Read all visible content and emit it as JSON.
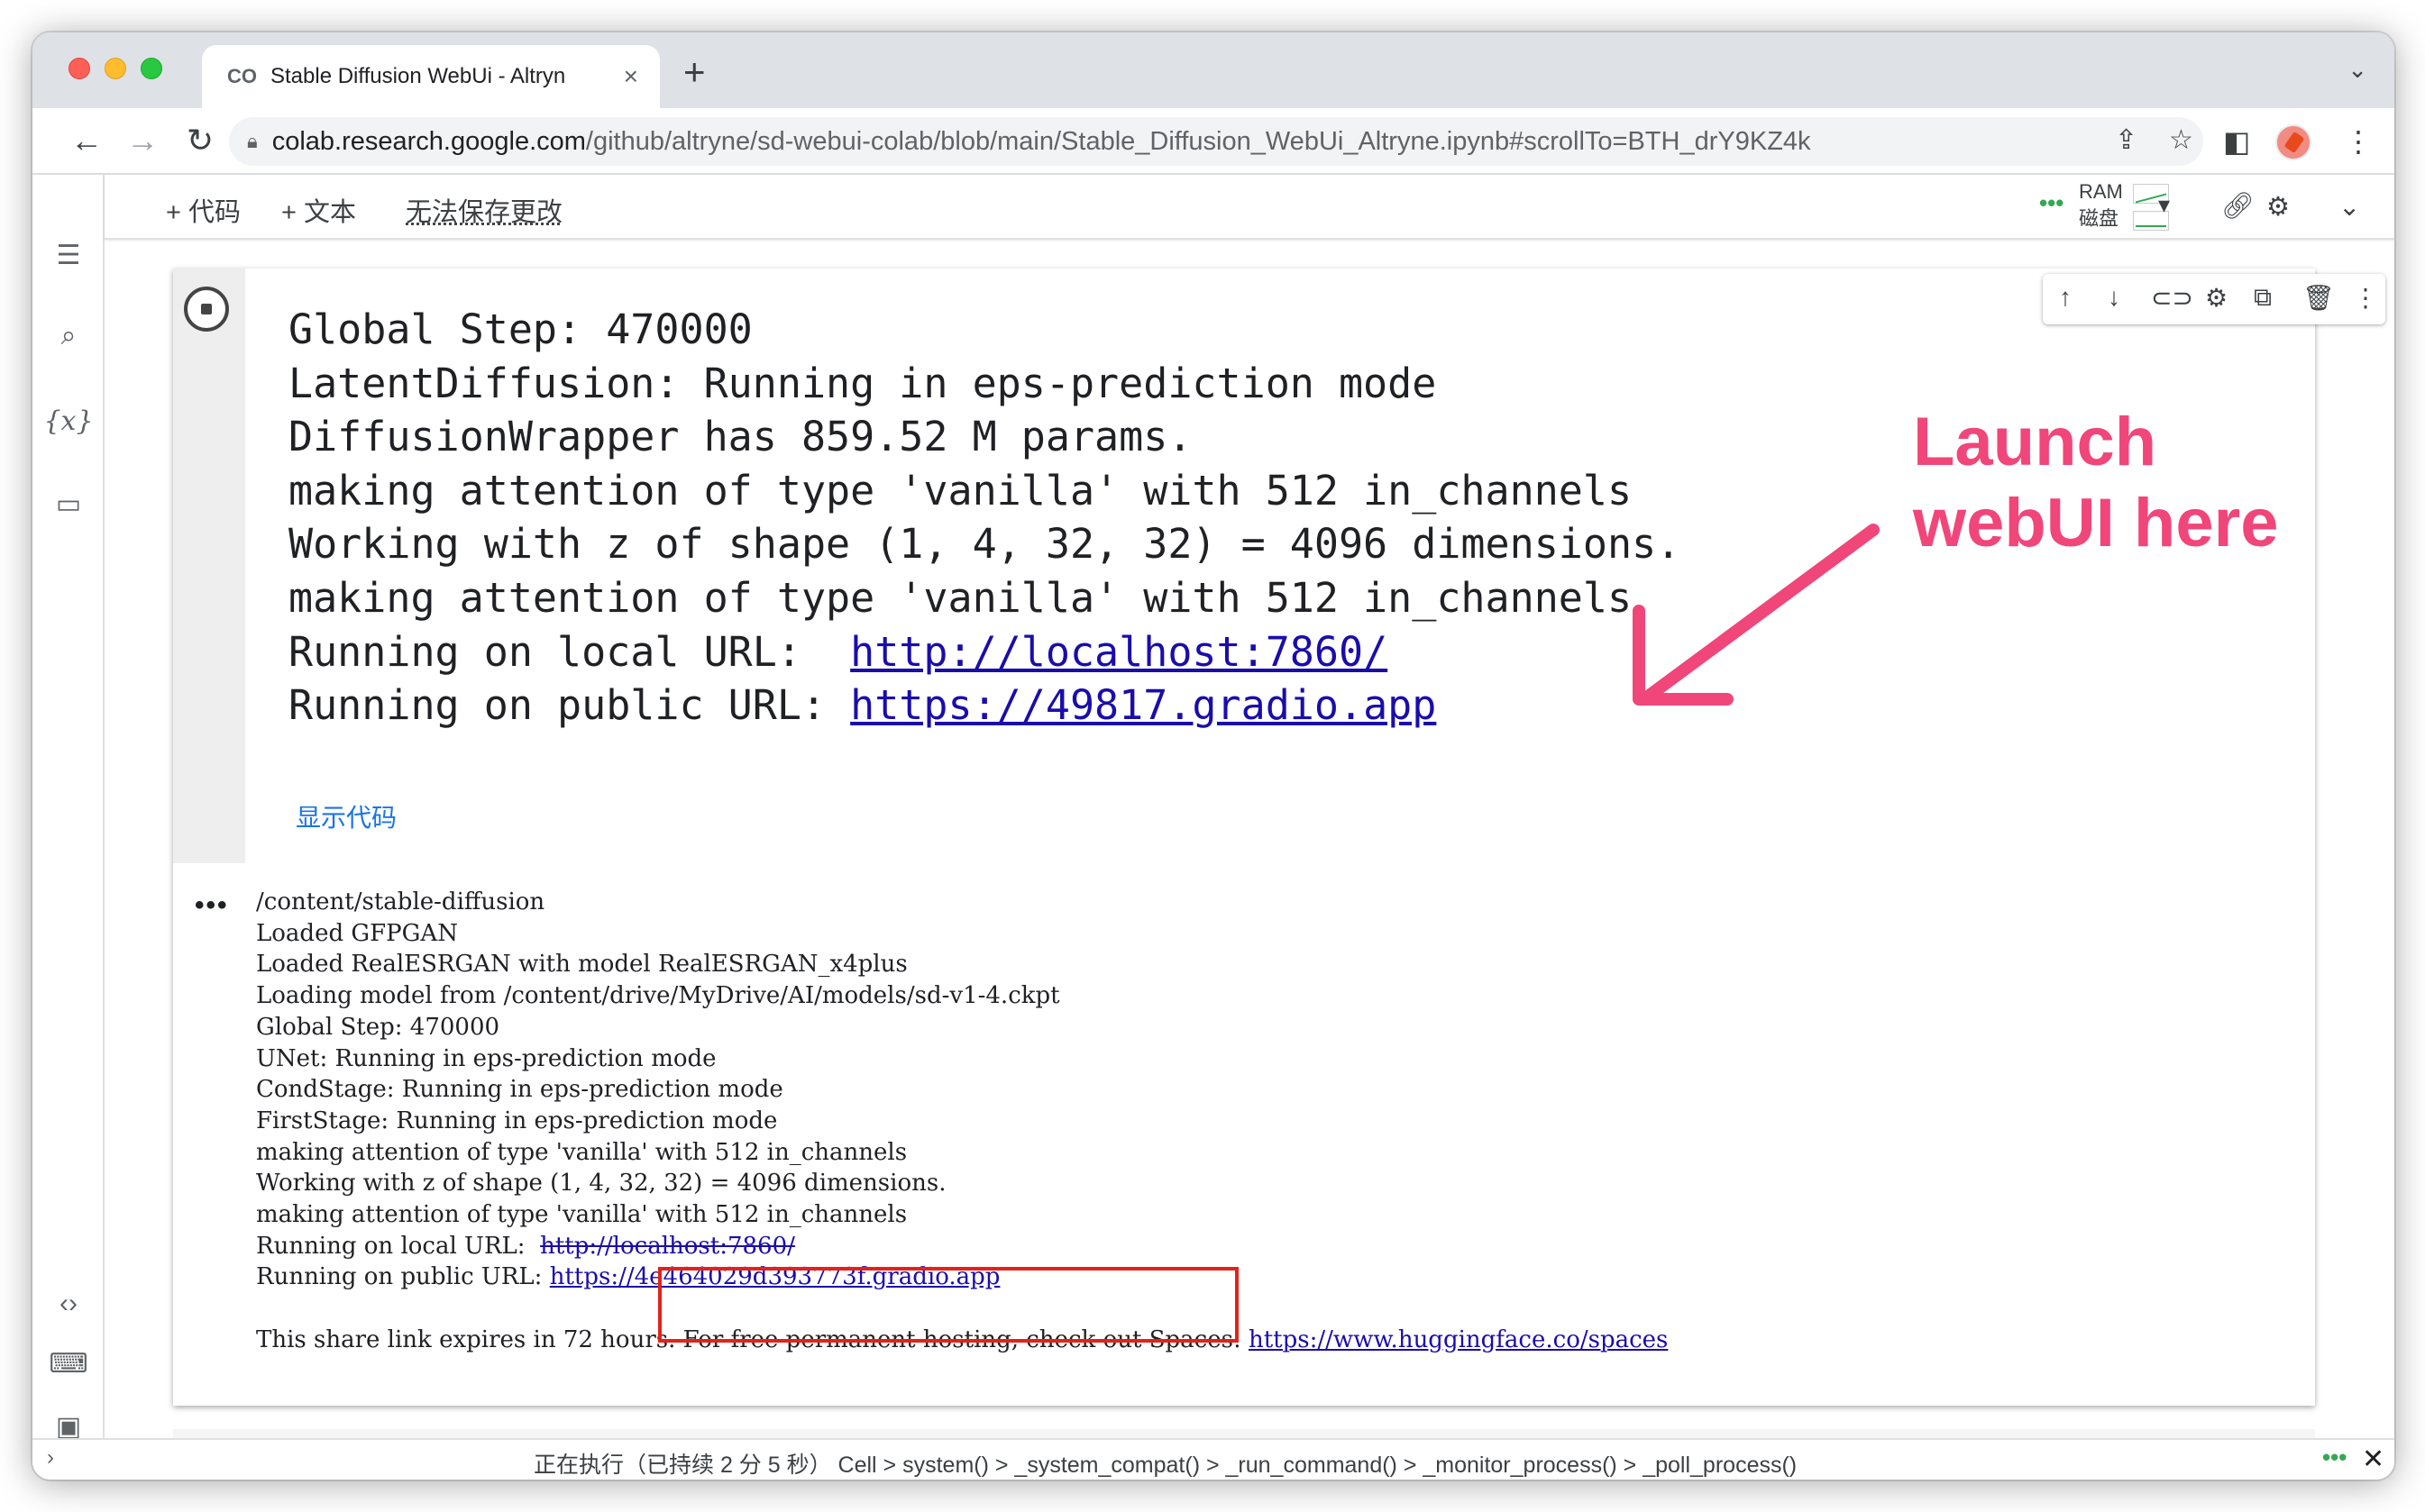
{
  "browser": {
    "tab_title": "Stable Diffusion WebUi - Altryn",
    "tab_close": "×",
    "new_tab": "+",
    "tab_search": "⌄",
    "url_host": "colab.research.google.com",
    "url_path": "/github/altryne/sd-webui-colab/blob/main/Stable_Diffusion_WebUi_Altryne.ipynb#scrollTo=BTH_drY9KZ4k"
  },
  "colab_header": {
    "add_code": "+ 代码",
    "add_text": "+ 文本",
    "save_status": "无法保存更改",
    "ram_label": "RAM",
    "disk_label": "磁盘",
    "dropdown": "▾"
  },
  "cell_form_output": {
    "lines": [
      "Global Step: 470000",
      "LatentDiffusion: Running in eps-prediction mode",
      "DiffusionWrapper has 859.52 M params.",
      "making attention of type 'vanilla' with 512 in_channels",
      "Working with z of shape (1, 4, 32, 32) = 4096 dimensions.",
      "making attention of type 'vanilla' with 512 in_channels"
    ],
    "local_prefix": "Running on local URL:  ",
    "local_url": "http://localhost:7860/",
    "public_prefix": "Running on public URL: ",
    "public_url": "https://49817.gradio.app",
    "show_code": "显示代码"
  },
  "cell_output": {
    "lines": [
      "/content/stable-diffusion",
      "Loaded GFPGAN",
      "Loaded RealESRGAN with model RealESRGAN_x4plus",
      "Loading model from /content/drive/MyDrive/AI/models/sd-v1-4.ckpt",
      "Global Step: 470000",
      "UNet: Running in eps-prediction mode",
      "CondStage: Running in eps-prediction mode",
      "FirstStage: Running in eps-prediction mode",
      "making attention of type 'vanilla' with 512 in_channels",
      "Working with z of shape (1, 4, 32, 32) = 4096 dimensions.",
      "making attention of type 'vanilla' with 512 in_channels"
    ],
    "local_prefix": "Running on local URL:  ",
    "local_url": "http://localhost:7860/",
    "public_prefix": "Running on public URL: ",
    "public_url": "https://4e464029d393773f.gradio.app",
    "share_text": "This share link expires in 72 hours. For free permanent hosting, check out Spaces: ",
    "spaces_url": "https://www.huggingface.co/spaces"
  },
  "annotation": {
    "line1": "Launch",
    "line2": "webUI here",
    "color": "#f0467a"
  },
  "statusbar": {
    "text": "正在执行（已持续 2 分 5 秒）  Cell > system() > _system_compat() > _run_command() > _monitor_process() > _poll_process()",
    "close": "✕"
  }
}
